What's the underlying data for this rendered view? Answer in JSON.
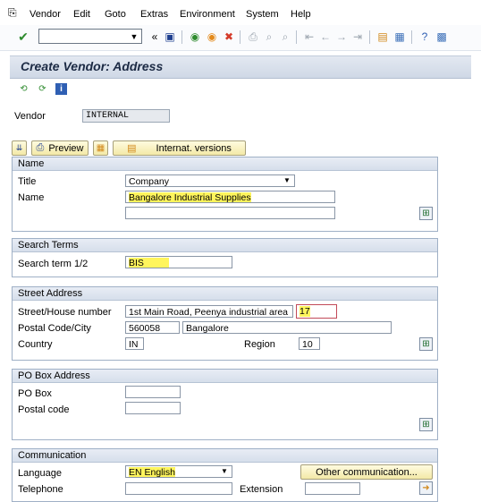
{
  "menu": {
    "items": [
      "Vendor",
      "Edit",
      "Goto",
      "Extras",
      "Environment",
      "System",
      "Help"
    ]
  },
  "window": {
    "title": "Create Vendor: Address"
  },
  "vendor": {
    "label": "Vendor",
    "value": "INTERNAL"
  },
  "buttons": {
    "preview": "Preview",
    "internat_versions": "Internat. versions",
    "other_communication": "Other communication..."
  },
  "name_group": {
    "title": "Name",
    "title_label": "Title",
    "title_value": "Company",
    "name_label": "Name",
    "name_value": "Bangalore Industrial Supplies",
    "name2_value": ""
  },
  "search_group": {
    "title": "Search Terms",
    "label": "Search term 1/2",
    "value": "BIS"
  },
  "street_group": {
    "title": "Street Address",
    "street_label": "Street/House number",
    "street_value": "1st Main Road, Peenya industrial area",
    "house_value": "17",
    "postal_label": "Postal Code/City",
    "postal_value": "560058",
    "city_value": "Bangalore",
    "country_label": "Country",
    "country_value": "IN",
    "region_label": "Region",
    "region_value": "10"
  },
  "pobox_group": {
    "title": "PO Box Address",
    "pobox_label": "PO Box",
    "pobox_value": "",
    "postal_label": "Postal code",
    "postal_value": ""
  },
  "comm_group": {
    "title": "Communication",
    "language_label": "Language",
    "language_value": "EN English",
    "telephone_label": "Telephone",
    "extension_label": "Extension"
  }
}
